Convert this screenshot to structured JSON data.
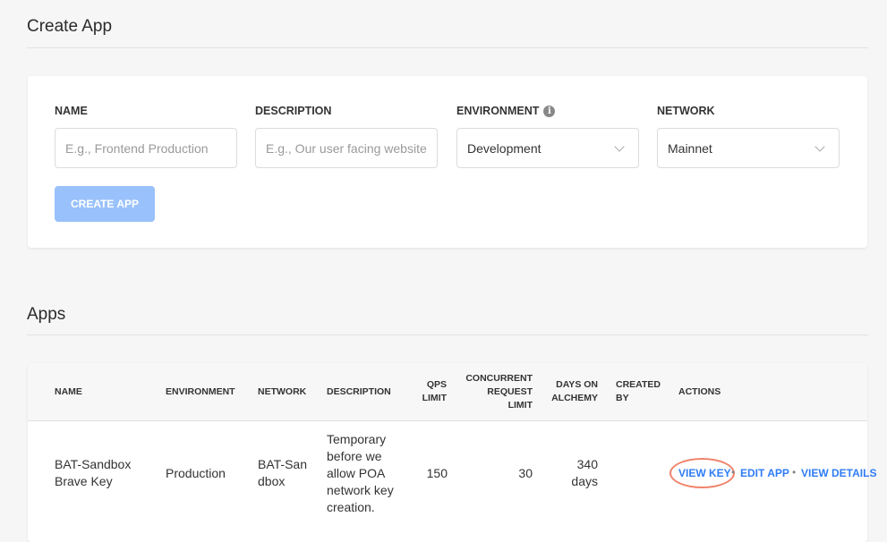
{
  "create": {
    "title": "Create App",
    "fields": [
      {
        "label": "NAME",
        "placeholder": "E.g., Frontend Production",
        "value": ""
      },
      {
        "label": "DESCRIPTION",
        "placeholder": "E.g., Our user facing website",
        "value": ""
      },
      {
        "label": "ENVIRONMENT",
        "value": "Development",
        "info_icon": "i"
      },
      {
        "label": "NETWORK",
        "value": "Mainnet"
      }
    ],
    "button": "CREATE APP",
    "button_color": "#99c1fb"
  },
  "apps": {
    "title": "Apps",
    "columns": [
      "NAME",
      "ENVIRONMENT",
      "NETWORK",
      "DESCRIPTION",
      "QPS LIMIT",
      "CONCURRENT REQUEST LIMIT",
      "DAYS ON ALCHEMY",
      "CREATED BY",
      "ACTIONS"
    ],
    "rows": [
      {
        "name": "BAT-Sandbox Brave Key",
        "environment": "Production",
        "network": "BAT-Sandbox",
        "description": "Temporary before we allow POA network key creation.",
        "qps": "150",
        "concurrent": "30",
        "days": "340 days",
        "created_by": "",
        "actions": [
          "VIEW KEY",
          "EDIT APP",
          "VIEW DETAILS"
        ],
        "separator": "•"
      }
    ],
    "link_color": "#2f7cf6",
    "highlight_color": "#f0826a"
  }
}
